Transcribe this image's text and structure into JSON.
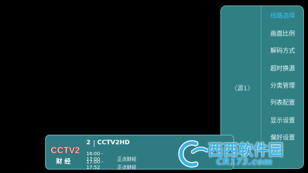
{
  "menu": {
    "source_label": "〈源1〉",
    "items": [
      {
        "label": "线路选择",
        "active": true
      },
      {
        "label": "画面比例",
        "active": false
      },
      {
        "label": "解码方式",
        "active": false
      },
      {
        "label": "超时换源",
        "active": false
      },
      {
        "label": "分类管理",
        "active": false
      },
      {
        "label": "列表配置",
        "active": false
      },
      {
        "label": "显示设置",
        "active": false
      },
      {
        "label": "偏好设置",
        "active": false
      }
    ]
  },
  "channel": {
    "logo_text": "CCTV2",
    "logo_sub": "财 经",
    "number": "2",
    "name": "CCTV2HD",
    "epg": [
      {
        "time": "16:00 - 17:00",
        "title": "正点财经"
      },
      {
        "time": "17:00 - 17:52",
        "title": "正点财经"
      }
    ]
  },
  "watermark": {
    "title": "西西软件园",
    "site": "CR173.com"
  },
  "colors": {
    "panel": "#2f7f83",
    "accent": "#39c4f4",
    "logo_red": "#c8161d"
  }
}
